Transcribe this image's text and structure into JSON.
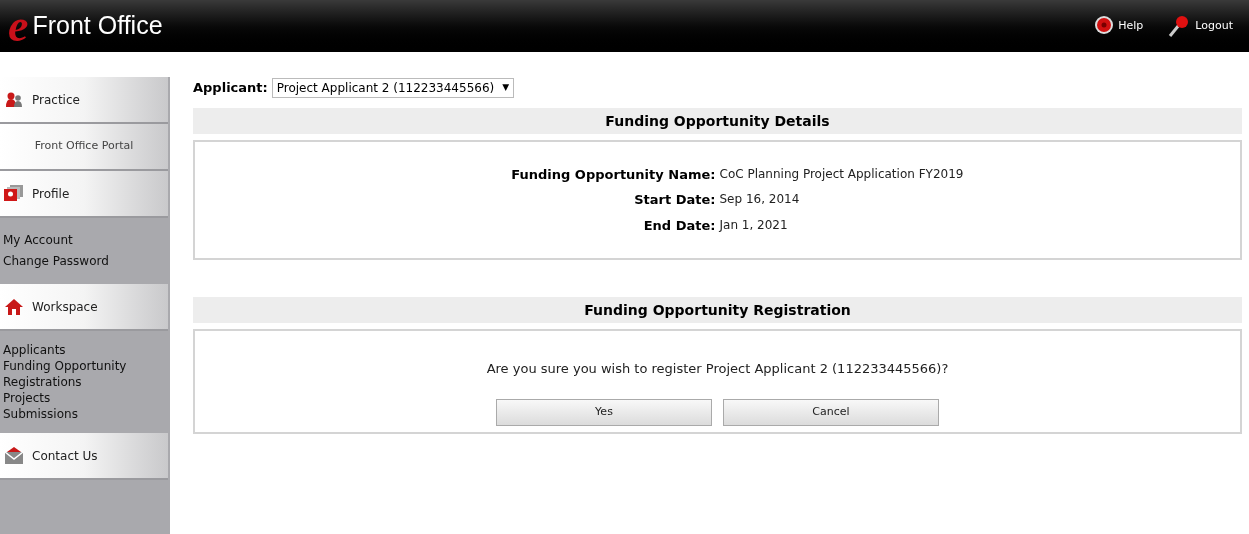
{
  "header": {
    "logo_mark": "e",
    "title": "Front Office",
    "actions": [
      {
        "label": "Help"
      },
      {
        "label": "Logout"
      }
    ]
  },
  "sidebar": [
    {
      "kind": "section",
      "label": "Practice"
    },
    {
      "kind": "tile",
      "label": "Front Office Portal"
    },
    {
      "kind": "section",
      "label": "Profile"
    },
    {
      "kind": "links",
      "items": [
        "My Account",
        "Change Password"
      ]
    },
    {
      "kind": "section",
      "label": "Workspace"
    },
    {
      "kind": "links",
      "items": [
        "Applicants",
        "Funding Opportunity Registrations",
        "Projects",
        "Submissions"
      ]
    },
    {
      "kind": "section",
      "label": "Contact Us"
    }
  ],
  "applicant": {
    "label": "Applicant:",
    "value": "Project Applicant 2 (112233445566)",
    "caret": "▼"
  },
  "details": {
    "title": "Funding Opportunity Details",
    "fields": [
      {
        "label": "Funding Opportunity Name:",
        "value": "CoC Planning Project Application FY2019"
      },
      {
        "label": "Start Date:",
        "value": "Sep 16, 2014"
      },
      {
        "label": "End Date:",
        "value": "Jan 1, 2021"
      }
    ]
  },
  "registration": {
    "title": "Funding Opportunity Registration",
    "question": "Are you sure you wish to register Project Applicant 2 (112233445566)?",
    "buttons": [
      "Yes",
      "Cancel"
    ]
  }
}
